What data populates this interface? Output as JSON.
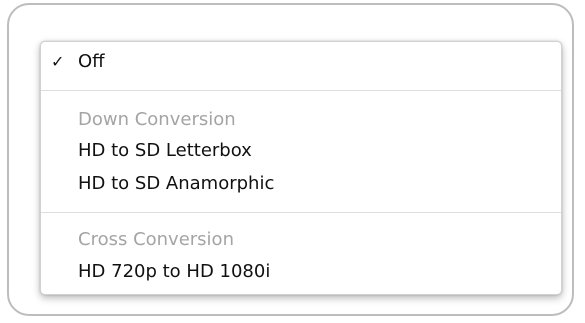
{
  "menu": {
    "selected_item": {
      "check_glyph": "✓",
      "label": "Off"
    },
    "groups": [
      {
        "header": "Down Conversion",
        "items": [
          "HD to SD Letterbox",
          "HD to SD Anamorphic"
        ]
      },
      {
        "header": "Cross Conversion",
        "items": [
          "HD 720p to HD 1080i"
        ]
      }
    ]
  },
  "colors": {
    "text": "#111111",
    "header_text": "#a4a4a4",
    "separator": "#dedede",
    "frame_border": "#bdbdbd"
  }
}
